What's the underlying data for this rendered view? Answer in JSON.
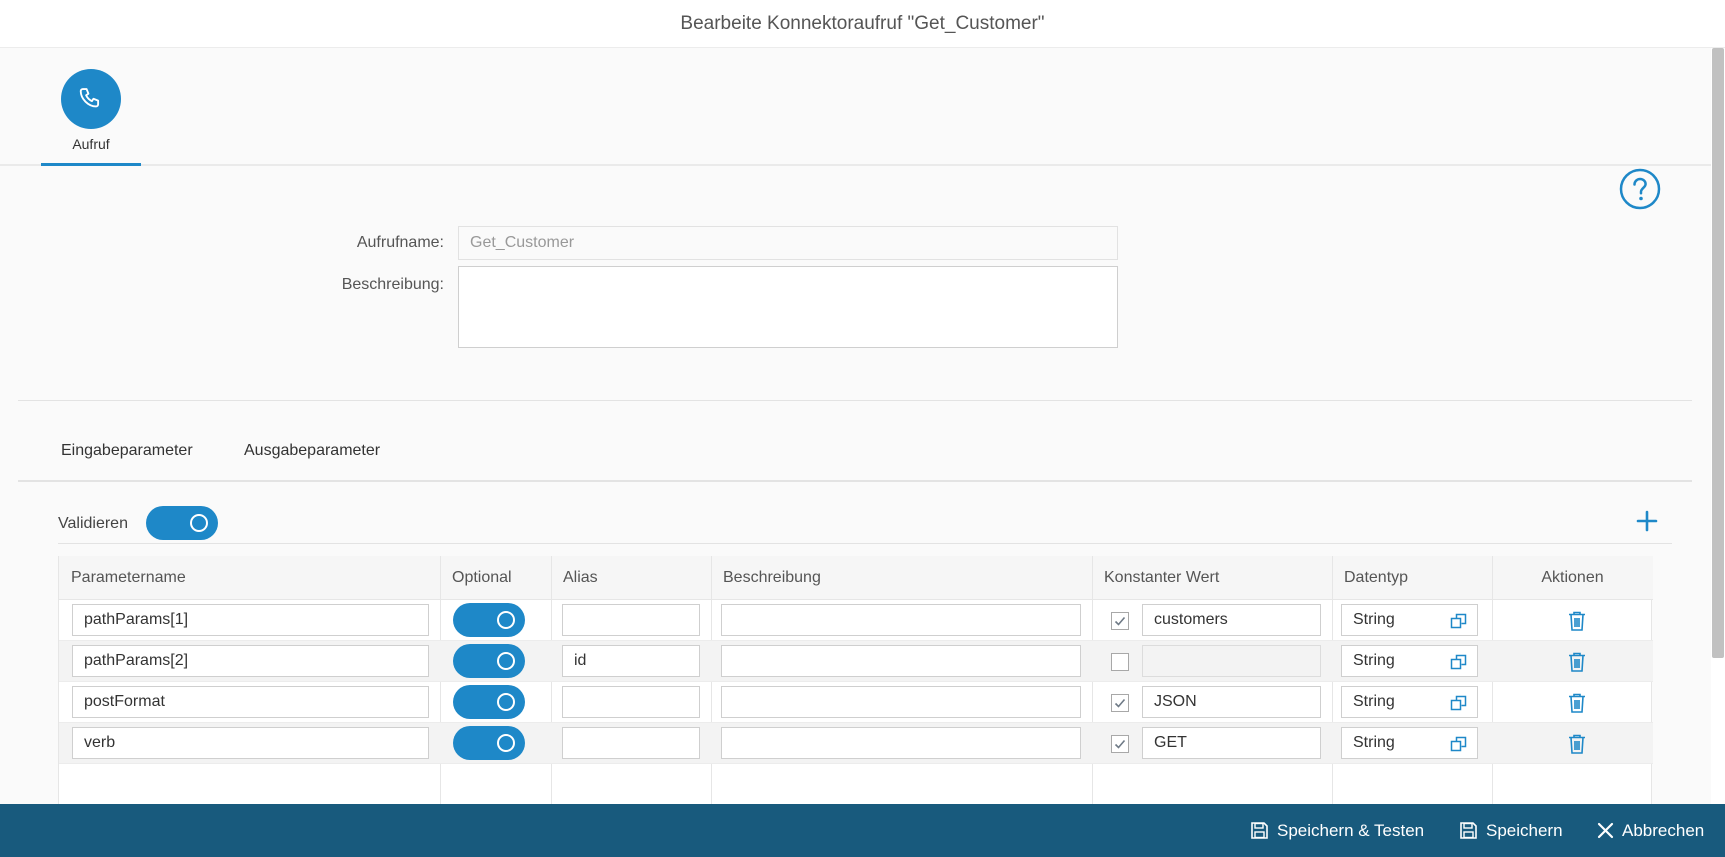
{
  "window": {
    "title": "Bearbeite Konnektoraufruf \"Get_Customer\""
  },
  "icon_tabs": [
    {
      "label": "Aufruf",
      "icon": "phone-icon",
      "active": true
    }
  ],
  "form": {
    "name_label": "Aufrufname:",
    "name_value": "Get_Customer",
    "description_label": "Beschreibung:",
    "description_value": ""
  },
  "param_tabs": [
    {
      "label": "Eingabeparameter"
    },
    {
      "label": "Ausgabeparameter"
    }
  ],
  "validate": {
    "label": "Validieren",
    "on": true
  },
  "table": {
    "headers": [
      "Parametername",
      "Optional",
      "Alias",
      "Beschreibung",
      "Konstanter Wert",
      "Datentyp",
      "Aktionen"
    ],
    "rows": [
      {
        "name": "pathParams[1]",
        "optional": true,
        "alias": "",
        "description": "",
        "constant_checked": true,
        "constant_value": "customers",
        "datatype": "String"
      },
      {
        "name": "pathParams[2]",
        "optional": true,
        "alias": "id",
        "description": "",
        "constant_checked": false,
        "constant_value": "",
        "datatype": "String"
      },
      {
        "name": "postFormat",
        "optional": true,
        "alias": "",
        "description": "",
        "constant_checked": true,
        "constant_value": "JSON",
        "datatype": "String"
      },
      {
        "name": "verb",
        "optional": true,
        "alias": "",
        "description": "",
        "constant_checked": true,
        "constant_value": "GET",
        "datatype": "String"
      }
    ]
  },
  "footer": {
    "save_test_label": "Speichern & Testen",
    "save_label": "Speichern",
    "cancel_label": "Abbrechen"
  },
  "colors": {
    "accent": "#1e88c8",
    "footer": "#185a7d"
  }
}
